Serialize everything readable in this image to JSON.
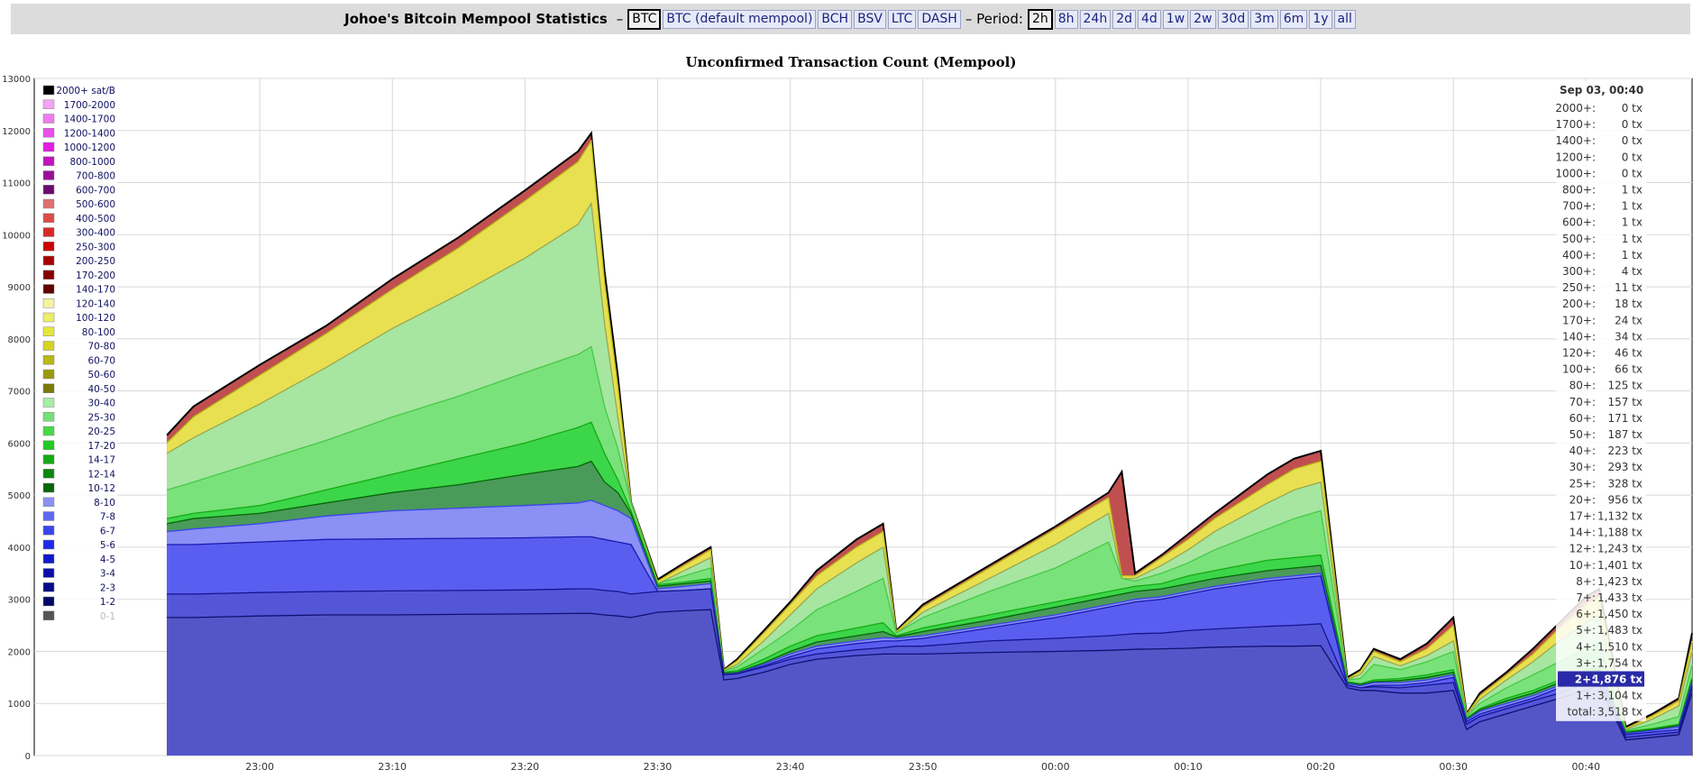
{
  "header": {
    "title": "Johoe's Bitcoin Mempool Statistics",
    "dash": "–",
    "coins": [
      {
        "label": "BTC",
        "active": true
      },
      {
        "label": "BTC (default mempool)",
        "active": false
      },
      {
        "label": "BCH",
        "active": false
      },
      {
        "label": "BSV",
        "active": false
      },
      {
        "label": "LTC",
        "active": false
      },
      {
        "label": "DASH",
        "active": false
      }
    ],
    "period_label": "– Period:",
    "periods": [
      {
        "label": "2h",
        "active": true
      },
      {
        "label": "8h",
        "active": false
      },
      {
        "label": "24h",
        "active": false
      },
      {
        "label": "2d",
        "active": false
      },
      {
        "label": "4d",
        "active": false
      },
      {
        "label": "1w",
        "active": false
      },
      {
        "label": "2w",
        "active": false
      },
      {
        "label": "30d",
        "active": false
      },
      {
        "label": "3m",
        "active": false
      },
      {
        "label": "6m",
        "active": false
      },
      {
        "label": "1y",
        "active": false
      },
      {
        "label": "all",
        "active": false
      }
    ]
  },
  "chart_data": {
    "type": "area",
    "title": "Unconfirmed Transaction Count (Mempool)",
    "ylim": [
      0,
      13000
    ],
    "yticks": [
      0,
      1000,
      2000,
      3000,
      4000,
      5000,
      6000,
      7000,
      8000,
      9000,
      10000,
      11000,
      12000,
      13000
    ],
    "xlim_minutes": [
      -17,
      108
    ],
    "xticks": [
      {
        "label": "23:00",
        "m": 0
      },
      {
        "label": "23:10",
        "m": 10
      },
      {
        "label": "23:20",
        "m": 20
      },
      {
        "label": "23:30",
        "m": 30
      },
      {
        "label": "23:40",
        "m": 40
      },
      {
        "label": "23:50",
        "m": 50
      },
      {
        "label": "00:00",
        "m": 60
      },
      {
        "label": "00:10",
        "m": 70
      },
      {
        "label": "00:20",
        "m": 80
      },
      {
        "label": "00:30",
        "m": 90
      },
      {
        "label": "00:40",
        "m": 100
      },
      {
        "label": "00:50",
        "m": 110
      }
    ],
    "x_minutes": [
      -7,
      -5,
      0,
      5,
      10,
      15,
      20,
      24,
      25,
      26,
      27,
      28,
      30,
      32,
      34,
      35,
      36,
      38,
      40,
      42,
      45,
      47,
      48,
      50,
      55,
      60,
      64,
      65,
      66,
      68,
      70,
      72,
      76,
      78,
      80,
      82,
      83,
      84,
      86,
      88,
      90,
      91,
      92,
      94,
      96,
      98,
      100,
      101,
      103,
      105,
      107,
      108
    ],
    "series": [
      {
        "name": "1-2",
        "values": [
          2650,
          2650,
          2680,
          2700,
          2700,
          2710,
          2720,
          2730,
          2730,
          2700,
          2680,
          2650,
          2750,
          2780,
          2800,
          1450,
          1480,
          1600,
          1750,
          1850,
          1920,
          1950,
          1950,
          1950,
          1980,
          2000,
          2020,
          2030,
          2040,
          2050,
          2060,
          2080,
          2100,
          2100,
          2110,
          1300,
          1250,
          1250,
          1200,
          1200,
          1250,
          500,
          650,
          800,
          950,
          1100,
          1250,
          1350,
          300,
          350,
          400,
          1200
        ]
      },
      {
        "name": "2-3",
        "values": [
          3100,
          3100,
          3130,
          3150,
          3160,
          3170,
          3180,
          3200,
          3200,
          3170,
          3150,
          3100,
          3150,
          3170,
          3200,
          1550,
          1570,
          1700,
          1850,
          1950,
          2030,
          2070,
          2100,
          2100,
          2200,
          2250,
          2300,
          2320,
          2340,
          2350,
          2400,
          2430,
          2480,
          2500,
          2530,
          1350,
          1300,
          1320,
          1300,
          1350,
          1400,
          600,
          750,
          900,
          1050,
          1200,
          1400,
          1450,
          350,
          400,
          450,
          1300
        ]
      },
      {
        "name": "3-4",
        "values": [
          4050,
          4050,
          4100,
          4150,
          4160,
          4170,
          4180,
          4200,
          4200,
          4150,
          4100,
          4050,
          3150,
          3170,
          3200,
          1550,
          1570,
          1720,
          1900,
          2050,
          2150,
          2200,
          2200,
          2250,
          2450,
          2650,
          2850,
          2900,
          2950,
          3000,
          3100,
          3200,
          3350,
          3400,
          3450,
          1350,
          1300,
          1350,
          1350,
          1400,
          1500,
          650,
          800,
          950,
          1100,
          1300,
          1500,
          1550,
          400,
          450,
          500,
          1350
        ]
      },
      {
        "name": "7-8",
        "values": [
          4300,
          4350,
          4450,
          4600,
          4700,
          4750,
          4800,
          4850,
          4900,
          4800,
          4700,
          4550,
          3200,
          3250,
          3300,
          1560,
          1580,
          1750,
          1950,
          2100,
          2200,
          2260,
          2250,
          2300,
          2500,
          2700,
          2900,
          2950,
          3000,
          3050,
          3150,
          3250,
          3400,
          3450,
          3500,
          1380,
          1340,
          1400,
          1400,
          1450,
          1550,
          680,
          850,
          1000,
          1150,
          1350,
          1550,
          1600,
          420,
          480,
          550,
          1400
        ]
      },
      {
        "name": "10-12",
        "values": [
          4450,
          4550,
          4650,
          4850,
          5050,
          5200,
          5400,
          5550,
          5650,
          5250,
          5050,
          4650,
          3250,
          3300,
          3350,
          1580,
          1600,
          1780,
          2000,
          2180,
          2300,
          2380,
          2280,
          2380,
          2600,
          2850,
          3050,
          3100,
          3150,
          3200,
          3300,
          3400,
          3550,
          3600,
          3650,
          1400,
          1360,
          1420,
          1440,
          1500,
          1600,
          700,
          880,
          1050,
          1200,
          1400,
          1600,
          1650,
          440,
          500,
          580,
          1450
        ]
      },
      {
        "name": "17-20",
        "values": [
          4550,
          4650,
          4800,
          5100,
          5400,
          5700,
          6000,
          6300,
          6400,
          5800,
          5300,
          4700,
          3280,
          3330,
          3400,
          1600,
          1630,
          1850,
          2100,
          2300,
          2450,
          2550,
          2300,
          2450,
          2700,
          2950,
          3150,
          3200,
          3250,
          3300,
          3450,
          3550,
          3750,
          3800,
          3850,
          1420,
          1380,
          1450,
          1480,
          1550,
          1650,
          720,
          900,
          1100,
          1250,
          1450,
          1650,
          1700,
          460,
          520,
          600,
          1500
        ]
      },
      {
        "name": "20-25",
        "values": [
          5100,
          5250,
          5650,
          6050,
          6500,
          6900,
          7350,
          7700,
          7850,
          6700,
          5900,
          4850,
          3300,
          3450,
          3600,
          1620,
          1700,
          2050,
          2400,
          2800,
          3150,
          3400,
          2350,
          2650,
          3150,
          3600,
          4100,
          3400,
          3350,
          3500,
          3700,
          3950,
          4350,
          4550,
          4700,
          1450,
          1480,
          1750,
          1650,
          1800,
          2000,
          750,
          1000,
          1300,
          1550,
          1800,
          2050,
          2150,
          480,
          600,
          750,
          1750
        ]
      },
      {
        "name": "40-50",
        "values": [
          5800,
          6100,
          6750,
          7450,
          8200,
          8850,
          9550,
          10200,
          10600,
          8300,
          6500,
          4850,
          3300,
          3550,
          3800,
          1630,
          1750,
          2200,
          2700,
          3200,
          3700,
          4000,
          2350,
          2750,
          3400,
          4050,
          4650,
          3400,
          3400,
          3650,
          3950,
          4300,
          4850,
          5100,
          5250,
          1460,
          1560,
          1900,
          1720,
          1920,
          2200,
          770,
          1080,
          1450,
          1800,
          2200,
          2550,
          2700,
          500,
          700,
          950,
          2000
        ]
      },
      {
        "name": "100-120",
        "values": [
          6000,
          6500,
          7300,
          8100,
          8950,
          9750,
          10650,
          11400,
          11800,
          9100,
          7100,
          4870,
          3350,
          3650,
          3950,
          1640,
          1820,
          2350,
          2900,
          3450,
          4000,
          4300,
          2380,
          2850,
          3600,
          4350,
          4950,
          3450,
          3450,
          3800,
          4150,
          4550,
          5200,
          5500,
          5650,
          1470,
          1620,
          2000,
          1800,
          2050,
          2500,
          790,
          1150,
          1550,
          1950,
          2450,
          2900,
          3050,
          520,
          760,
          1050,
          2200
        ]
      },
      {
        "name": "2000+",
        "values": [
          6150,
          6700,
          7500,
          8250,
          9150,
          9950,
          10850,
          11600,
          11950,
          9300,
          7300,
          4870,
          3380,
          3700,
          4000,
          1650,
          1850,
          2400,
          2950,
          3550,
          4150,
          4450,
          2400,
          2900,
          3650,
          4400,
          5050,
          5450,
          3500,
          3850,
          4250,
          4650,
          5400,
          5700,
          5850,
          1500,
          1650,
          2050,
          1850,
          2150,
          2650,
          800,
          1200,
          1600,
          2050,
          2550,
          3050,
          3200,
          550,
          800,
          1100,
          2350
        ]
      }
    ],
    "legend": [
      {
        "label": "2000+ sat/B",
        "color": "#000000"
      },
      {
        "label": "1700-2000",
        "color": "#f5a3f5"
      },
      {
        "label": "1400-1700",
        "color": "#f07af0"
      },
      {
        "label": "1200-1400",
        "color": "#ea4fea"
      },
      {
        "label": "1000-1200",
        "color": "#e21ee2"
      },
      {
        "label": "800-1000",
        "color": "#c014c0"
      },
      {
        "label": "700-800",
        "color": "#9a0e9a"
      },
      {
        "label": "600-700",
        "color": "#6e0a6e"
      },
      {
        "label": "500-600",
        "color": "#e07070"
      },
      {
        "label": "400-500",
        "color": "#dd4a4a"
      },
      {
        "label": "300-400",
        "color": "#d82a2a"
      },
      {
        "label": "250-300",
        "color": "#cc0000"
      },
      {
        "label": "200-250",
        "color": "#a80000"
      },
      {
        "label": "170-200",
        "color": "#860000"
      },
      {
        "label": "140-170",
        "color": "#620000"
      },
      {
        "label": "120-140",
        "color": "#f3f3a0"
      },
      {
        "label": "100-120",
        "color": "#eeee6a"
      },
      {
        "label": "80-100",
        "color": "#e6e63a"
      },
      {
        "label": "70-80",
        "color": "#d4d420"
      },
      {
        "label": "60-70",
        "color": "#b8b816"
      },
      {
        "label": "50-60",
        "color": "#9a9a10"
      },
      {
        "label": "40-50",
        "color": "#7a7a0a"
      },
      {
        "label": "30-40",
        "color": "#a6eca6"
      },
      {
        "label": "25-30",
        "color": "#74e074"
      },
      {
        "label": "20-25",
        "color": "#48d848"
      },
      {
        "label": "17-20",
        "color": "#20cc20"
      },
      {
        "label": "14-17",
        "color": "#14aa14"
      },
      {
        "label": "12-14",
        "color": "#0c880c"
      },
      {
        "label": "10-12",
        "color": "#066606"
      },
      {
        "label": "8-10",
        "color": "#8a90f4"
      },
      {
        "label": "7-8",
        "color": "#6068f0"
      },
      {
        "label": "6-7",
        "color": "#3a44ec"
      },
      {
        "label": "5-6",
        "color": "#1e2ae6"
      },
      {
        "label": "4-5",
        "color": "#1018cc"
      },
      {
        "label": "3-4",
        "color": "#0a10aa"
      },
      {
        "label": "2-3",
        "color": "#060c88"
      },
      {
        "label": "1-2",
        "color": "#040866"
      },
      {
        "label": "0-1",
        "color": "#555555"
      }
    ],
    "tooltip": {
      "title": "Sep 03, 00:40",
      "rows": [
        {
          "label": "2000+:",
          "value": "0 tx"
        },
        {
          "label": "1700+:",
          "value": "0 tx"
        },
        {
          "label": "1400+:",
          "value": "0 tx"
        },
        {
          "label": "1200+:",
          "value": "0 tx"
        },
        {
          "label": "1000+:",
          "value": "0 tx"
        },
        {
          "label": "800+:",
          "value": "1 tx"
        },
        {
          "label": "700+:",
          "value": "1 tx"
        },
        {
          "label": "600+:",
          "value": "1 tx"
        },
        {
          "label": "500+:",
          "value": "1 tx"
        },
        {
          "label": "400+:",
          "value": "1 tx"
        },
        {
          "label": "300+:",
          "value": "4 tx"
        },
        {
          "label": "250+:",
          "value": "11 tx"
        },
        {
          "label": "200+:",
          "value": "18 tx"
        },
        {
          "label": "170+:",
          "value": "24 tx"
        },
        {
          "label": "140+:",
          "value": "34 tx"
        },
        {
          "label": "120+:",
          "value": "46 tx"
        },
        {
          "label": "100+:",
          "value": "66 tx"
        },
        {
          "label": "80+:",
          "value": "125 tx"
        },
        {
          "label": "70+:",
          "value": "157 tx"
        },
        {
          "label": "60+:",
          "value": "171 tx"
        },
        {
          "label": "50+:",
          "value": "187 tx"
        },
        {
          "label": "40+:",
          "value": "223 tx"
        },
        {
          "label": "30+:",
          "value": "293 tx"
        },
        {
          "label": "25+:",
          "value": "328 tx"
        },
        {
          "label": "20+:",
          "value": "956 tx"
        },
        {
          "label": "17+:",
          "value": "1,132 tx"
        },
        {
          "label": "14+:",
          "value": "1,188 tx"
        },
        {
          "label": "12+:",
          "value": "1,243 tx"
        },
        {
          "label": "10+:",
          "value": "1,401 tx"
        },
        {
          "label": "8+:",
          "value": "1,423 tx"
        },
        {
          "label": "7+:",
          "value": "1,433 tx"
        },
        {
          "label": "6+:",
          "value": "1,450 tx"
        },
        {
          "label": "5+:",
          "value": "1,483 tx"
        },
        {
          "label": "4+:",
          "value": "1,510 tx"
        },
        {
          "label": "3+:",
          "value": "1,754 tx"
        },
        {
          "label": "2+:",
          "value": "1,876 tx",
          "highlight": true
        },
        {
          "label": "1+:",
          "value": "3,104 tx"
        },
        {
          "label": "total:",
          "value": "3,518 tx"
        }
      ]
    }
  }
}
